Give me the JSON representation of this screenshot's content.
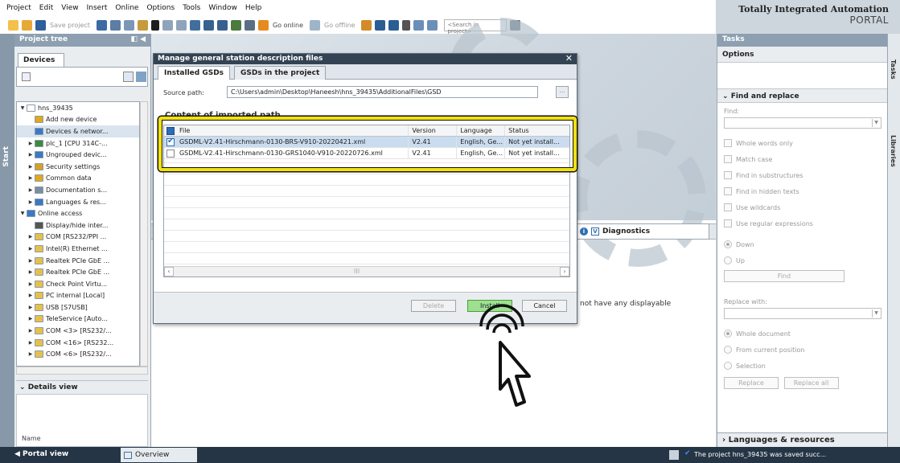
{
  "menu": [
    "Project",
    "Edit",
    "View",
    "Insert",
    "Online",
    "Options",
    "Tools",
    "Window",
    "Help"
  ],
  "toolbar": {
    "save_project": "Save project",
    "go_online": "Go online",
    "go_offline": "Go offline",
    "search_placeholder": "<Search in project>"
  },
  "brand": {
    "line1": "Totally Integrated Automation",
    "line2": "PORTAL"
  },
  "start_label": "Start",
  "project_tree": {
    "title": "Project tree",
    "devices_tab": "Devices",
    "items": [
      {
        "label": "hns_39435",
        "arrow": "▼",
        "color": "#ffffff",
        "sel": false,
        "indent": 0
      },
      {
        "label": "Add new device",
        "arrow": "",
        "color": "#e0a91c",
        "sel": false,
        "indent": 1
      },
      {
        "label": "Devices & networ...",
        "arrow": "",
        "color": "#3b79c3",
        "sel": true,
        "indent": 1
      },
      {
        "label": "plc_1 [CPU 314C-...",
        "arrow": "▶",
        "color": "#3e8a3c",
        "sel": false,
        "indent": 1
      },
      {
        "label": "Ungrouped devic...",
        "arrow": "▶",
        "color": "#3b79c3",
        "sel": false,
        "indent": 1
      },
      {
        "label": "Security settings",
        "arrow": "▶",
        "color": "#d5a225",
        "sel": false,
        "indent": 1
      },
      {
        "label": "Common data",
        "arrow": "▶",
        "color": "#e0a91c",
        "sel": false,
        "indent": 1
      },
      {
        "label": "Documentation s...",
        "arrow": "▶",
        "color": "#7a8ea0",
        "sel": false,
        "indent": 1
      },
      {
        "label": "Languages & res...",
        "arrow": "▶",
        "color": "#3b79c3",
        "sel": false,
        "indent": 1
      },
      {
        "label": "Online access",
        "arrow": "▼",
        "color": "#3b79c3",
        "sel": false,
        "indent": 0
      },
      {
        "label": "Display/hide inter...",
        "arrow": "",
        "color": "#555555",
        "sel": false,
        "indent": 1
      },
      {
        "label": "COM [RS232/PPI ...",
        "arrow": "▶",
        "color": "#e6c14a",
        "sel": false,
        "indent": 1
      },
      {
        "label": "Intel(R) Ethernet ...",
        "arrow": "▶",
        "color": "#e6c14a",
        "sel": false,
        "indent": 1
      },
      {
        "label": "Realtek PCIe GbE ...",
        "arrow": "▶",
        "color": "#e6c14a",
        "sel": false,
        "indent": 1
      },
      {
        "label": "Realtek PCIe GbE ...",
        "arrow": "▶",
        "color": "#e6c14a",
        "sel": false,
        "indent": 1
      },
      {
        "label": "Check Point Virtu...",
        "arrow": "▶",
        "color": "#e6c14a",
        "sel": false,
        "indent": 1
      },
      {
        "label": "PC internal [Local]",
        "arrow": "▶",
        "color": "#e6c14a",
        "sel": false,
        "indent": 1
      },
      {
        "label": "USB [S7USB]",
        "arrow": "▶",
        "color": "#e6c14a",
        "sel": false,
        "indent": 1
      },
      {
        "label": "TeleService [Auto...",
        "arrow": "▶",
        "color": "#e6c14a",
        "sel": false,
        "indent": 1
      },
      {
        "label": "COM <3> [RS232/...",
        "arrow": "▶",
        "color": "#e6c14a",
        "sel": false,
        "indent": 1
      },
      {
        "label": "COM <16> [RS232...",
        "arrow": "▶",
        "color": "#e6c14a",
        "sel": false,
        "indent": 1
      },
      {
        "label": "COM <6> [RS232/...",
        "arrow": "▶",
        "color": "#e6c14a",
        "sel": false,
        "indent": 1
      }
    ],
    "details_view": "Details view",
    "details_name": "Name"
  },
  "dialog": {
    "title": "Manage general station description files",
    "tab_installed": "Installed GSDs",
    "tab_project": "GSDs in the project",
    "source_label": "Source path:",
    "source_path": "C:\\Users\\admin\\Desktop\\Haneesh\\hns_39435\\AdditionalFiles\\GSD",
    "browse": "...",
    "content_header": "Content of imported path",
    "columns": [
      "File",
      "Version",
      "Language",
      "Status"
    ],
    "rows": [
      {
        "file": "GSDML-V2.41-Hirschmann-0130-BRS-V910-20220421.xml",
        "version": "V2.41",
        "language": "English, Ge...",
        "status": "Not yet install...",
        "checked": true,
        "selected": true
      },
      {
        "file": "GSDML-V2.41-Hirschmann-0130-GRS1040-V910-20220726.xml",
        "version": "V2.41",
        "language": "English, Ge...",
        "status": "Not yet install...",
        "checked": false,
        "selected": false
      }
    ],
    "scroll_mid": "III",
    "btn_delete": "Delete",
    "btn_install": "Install",
    "btn_cancel": "Cancel"
  },
  "inspector": {
    "diagnostics_tab": "Diagnostics",
    "no_display": "not have any displayable"
  },
  "tasks": {
    "title": "Tasks",
    "options": "Options",
    "find_replace": "Find and replace",
    "find_label": "Find:",
    "checks": [
      "Whole words only",
      "Match case",
      "Find in substructures",
      "Find in hidden texts",
      "Use wildcards",
      "Use regular expressions"
    ],
    "dir_down": "Down",
    "dir_up": "Up",
    "find_btn": "Find",
    "replace_with": "Replace with:",
    "scope": [
      "Whole document",
      "From current position",
      "Selection"
    ],
    "replace_btn": "Replace",
    "replace_all_btn": "Replace all",
    "languages_resources": "Languages & resources"
  },
  "right_tabs": [
    "Tasks",
    "Libraries"
  ],
  "status": {
    "portal_view": "◀  Portal view",
    "overview": "Overview",
    "message": "The project hns_39435 was saved succ..."
  }
}
